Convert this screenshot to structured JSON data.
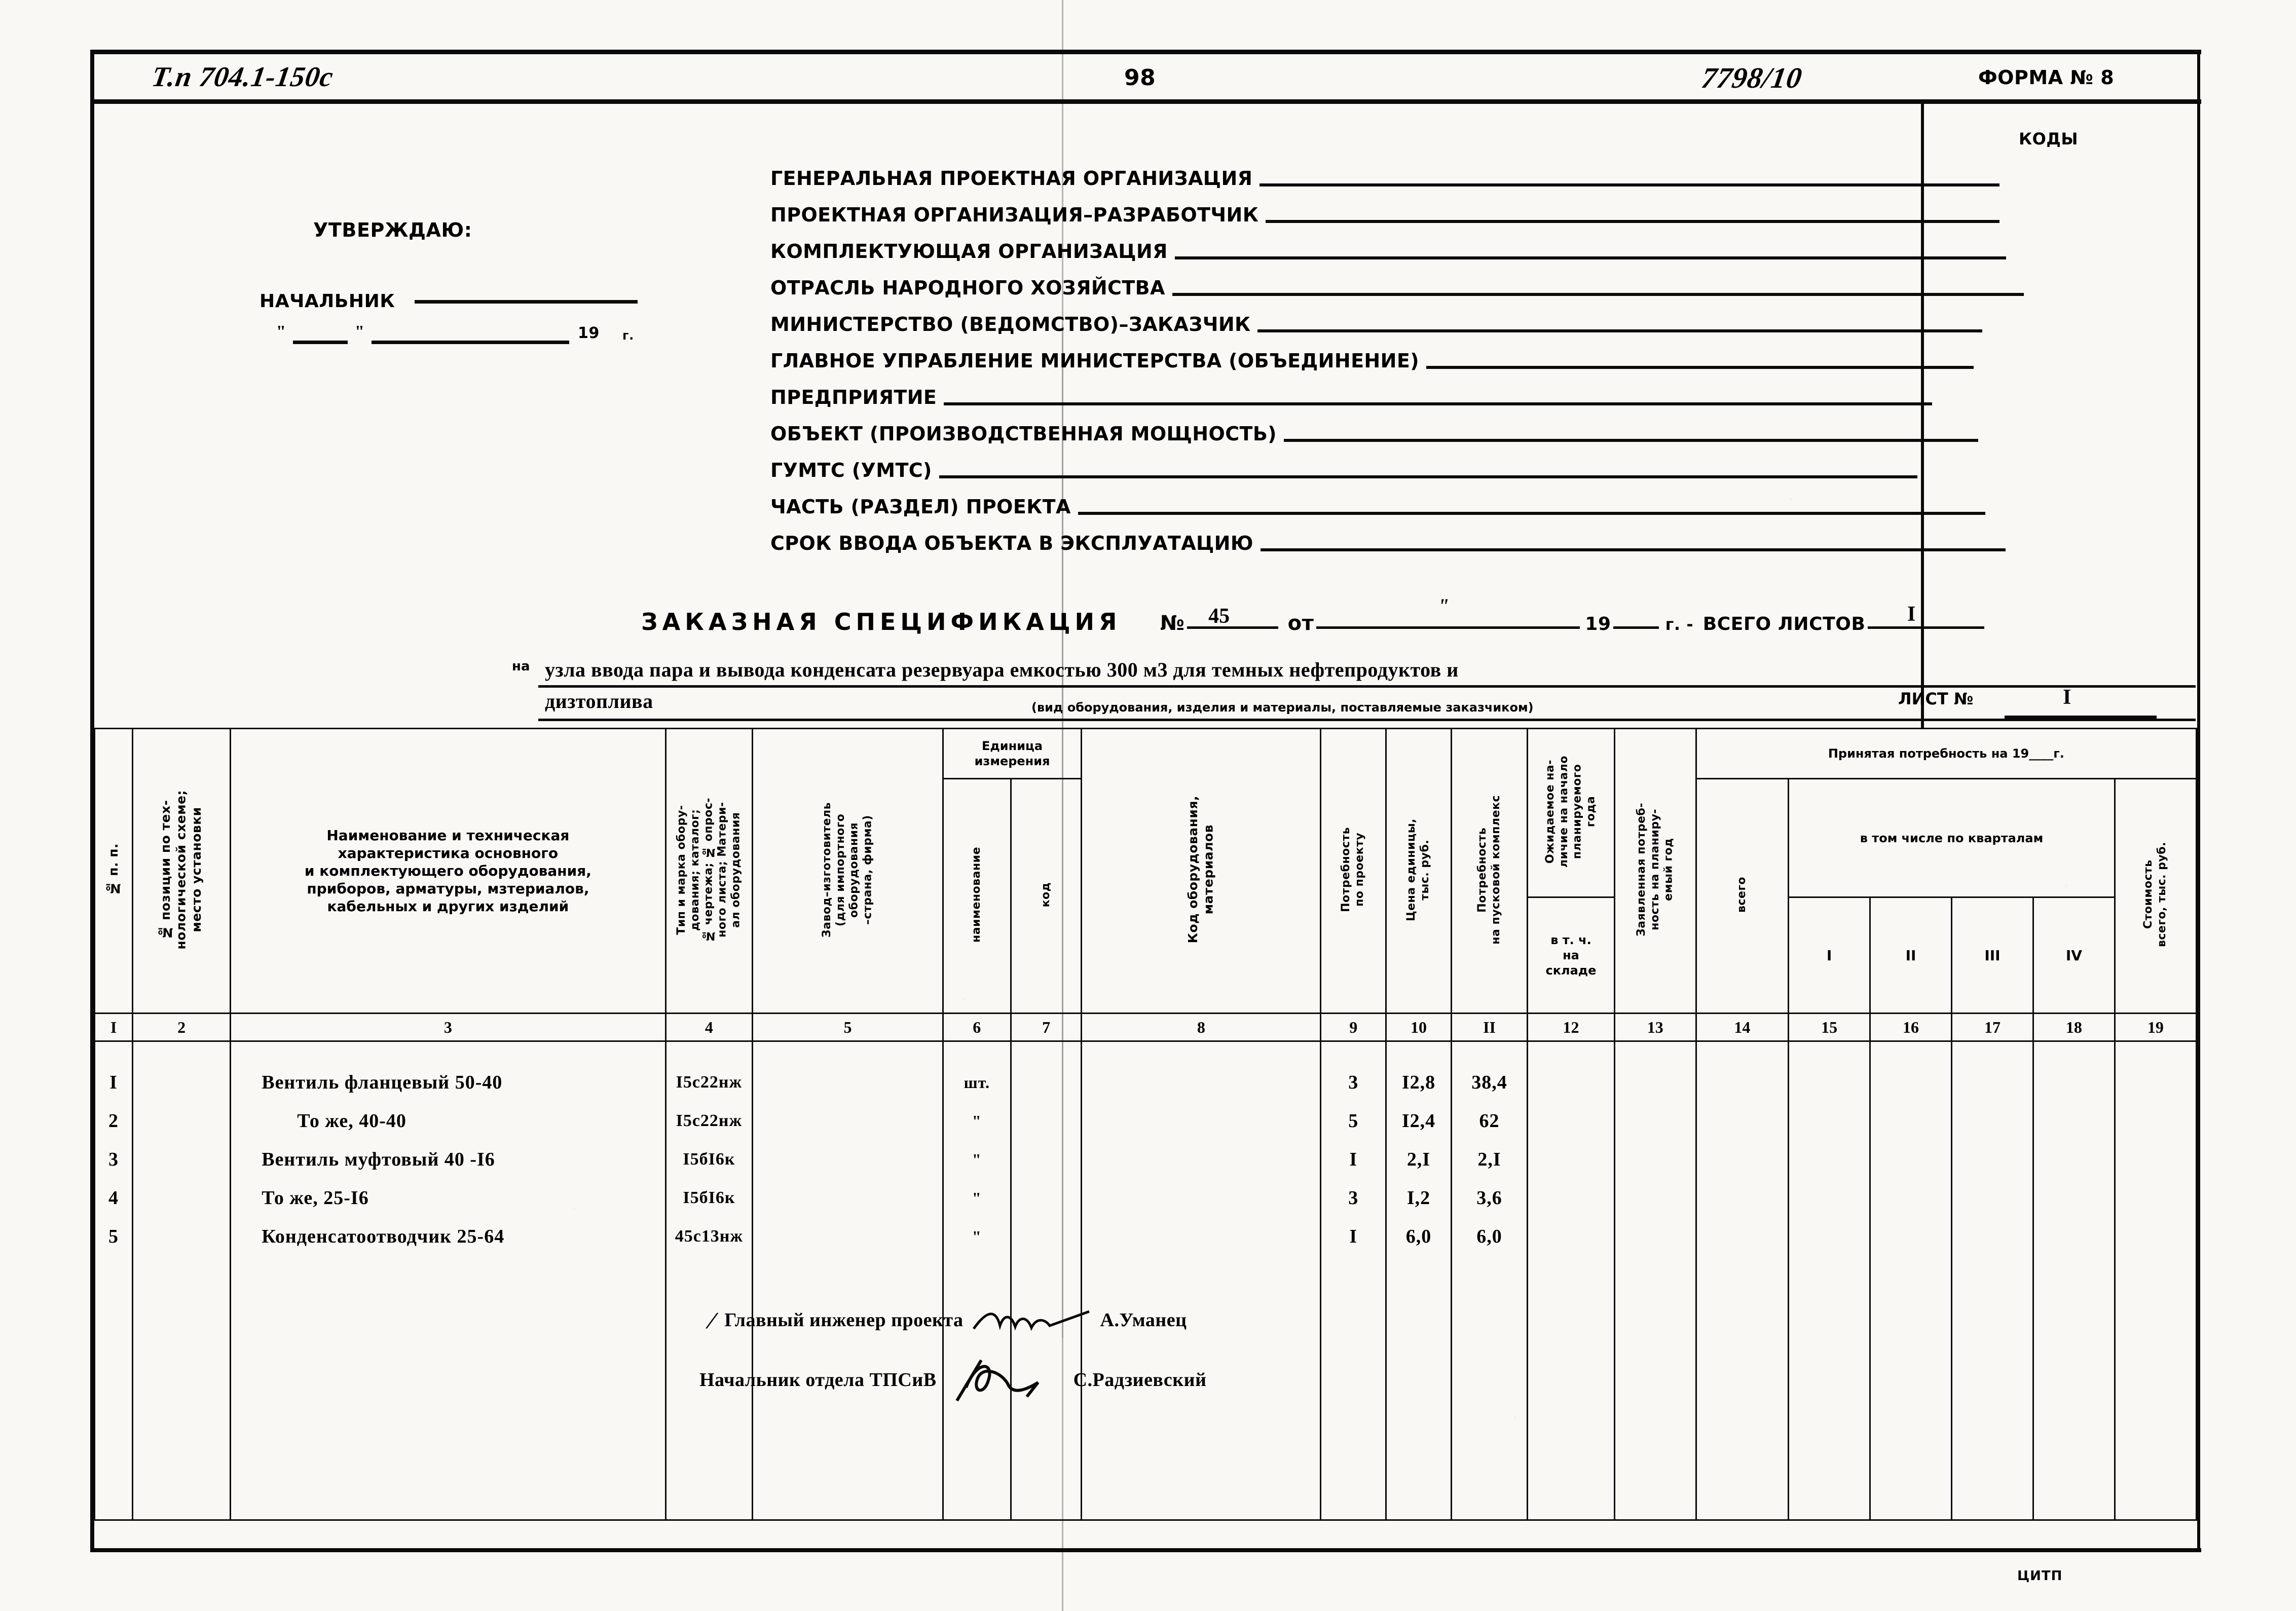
{
  "header": {
    "project_code": "Т.п 704.1-150с",
    "page_number": "98",
    "doc_number": "7798/10",
    "form_label": "ФОРМА № 8",
    "codes_label": "КОДЫ"
  },
  "approval": {
    "approve_label": "УТВЕРЖДАЮ:",
    "chief_label": "НАЧАЛЬНИК",
    "date_quote": "\"",
    "year_prefix": "19",
    "year_suffix": "г."
  },
  "org_fields": [
    "ГЕНЕРАЛЬНАЯ ПРОЕКТНАЯ ОРГАНИЗАЦИЯ",
    "ПРОЕКТНАЯ ОРГАНИЗАЦИЯ–РАЗРАБОТЧИК",
    "КОМПЛЕКТУЮЩАЯ ОРГАНИЗАЦИЯ",
    "ОТРАСЛЬ НАРОДНОГО ХОЗЯЙСТВА",
    "МИНИСТЕРСТВО (ВЕДОМСТВО)–ЗАКАЗЧИК",
    "ГЛАВНОЕ УПРАБЛЕНИЕ МИНИСТЕРСТВА (ОБЪЕДИНЕНИЕ)",
    "ПРЕДПРИЯТИЕ",
    "ОБЪЕКТ (ПРОИЗВОДСТВЕННАЯ МОЩНОСТЬ)",
    "ГУМТС (УМТС)",
    "ЧАСТЬ (РАЗДЕЛ) ПРОЕКТА",
    "СРОК ВВОДА ОБЪЕКТА В ЭКСПЛУАТАЦИЮ"
  ],
  "title": {
    "main": "ЗАКАЗНАЯ СПЕЦИФИКАЦИЯ",
    "number_label": "№",
    "number_value": "45",
    "from_label": "от",
    "quote_mark": "\"",
    "year_label": "19",
    "year_suffix": "г. -",
    "sheets_total_label": "ВСЕГО ЛИСТОВ",
    "sheets_total_value": "I",
    "na_prefix": "на",
    "subject_line1": "узла ввода пара и вывода конденсата резервуара емкостью 300 м3 для темных нефтепродуктов и",
    "subject_line2": "дизтоплива",
    "caption": "(вид оборудования, изделия и материалы, поставляемые заказчиком)",
    "sheet_label": "ЛИСТ №",
    "sheet_value": "I"
  },
  "table": {
    "headers": {
      "col1": "№ п. п.",
      "col2": "№ позиции по тех-\nнологической схеме;\nместо установки",
      "col3": "Наименование  и техническая\nхарактеристика основного\nи комплектующего оборудования,\nприборов, арматуры, мзтериалов,\nкабельных и других изделий",
      "col4": "Тип и марка обору-\nдования; каталог;\n№ чертежа; № опрос-\nного листа; Матери-\nал оборудования",
      "col5": "Завод–изготовитель\n(для импортного\nоборудования\n–страна, фирма)",
      "unit_group": "Единица\nизмерения",
      "col6": "наименование",
      "col7": "код",
      "col8": "Код оборудования,\nматериалов",
      "col9": "Потребность\nпо проекту",
      "col10": "Цена единицы,\nтыс. руб.",
      "col11": "Потребность\nна пусковой комплекс",
      "col12": "Ожидаемое на-\nличие на начало\nпланируемого\nгода",
      "col12b": "в т. ч.\nна\nскладе",
      "col13": "Заявленная потреб-\nность на планиру-\nемый год",
      "accepted_group": "Принятая потребность на 19____г.",
      "col14": "всего",
      "quarters_group": "в том числе по кварталам",
      "col15": "I",
      "col16": "II",
      "col17": "III",
      "col18": "IV",
      "col19": "Стоимость\nвсего, тыс. руб."
    },
    "column_numbers": [
      "I",
      "2",
      "3",
      "4",
      "5",
      "6",
      "7",
      "8",
      "9",
      "10",
      "II",
      "12",
      "13",
      "14",
      "15",
      "16",
      "17",
      "18",
      "19"
    ],
    "rows": [
      {
        "no": "I",
        "name": "Вентиль фланцевый  50-40",
        "mark": "I5с22нж",
        "unit": "шт.",
        "qty": "3",
        "price": "I2,8",
        "total": "38,4"
      },
      {
        "no": "2",
        "name": "То же, 40-40",
        "mark": "I5с22нж",
        "unit": "\"",
        "qty": "5",
        "price": "I2,4",
        "total": "62"
      },
      {
        "no": "3",
        "name": "Вентиль муфтовый 40 -I6",
        "mark": "I5бI6к",
        "unit": "\"",
        "qty": "I",
        "price": "2,I",
        "total": "2,I"
      },
      {
        "no": "4",
        "name": "То же, 25-I6",
        "mark": "I5бI6к",
        "unit": "\"",
        "qty": "3",
        "price": "I,2",
        "total": "3,6"
      },
      {
        "no": "5",
        "name": "Конденсатоотводчик 25-64",
        "mark": "45с13нж",
        "unit": "\"",
        "qty": "I",
        "price": "6,0",
        "total": "6,0"
      }
    ]
  },
  "signatures": [
    {
      "role": "Главный инженер проекта",
      "name": "А.Уманец"
    },
    {
      "role": "Начальник отдела ТПСиВ",
      "name": "С.Радзиевский"
    }
  ],
  "footer": {
    "publisher": "ЦИТП"
  }
}
